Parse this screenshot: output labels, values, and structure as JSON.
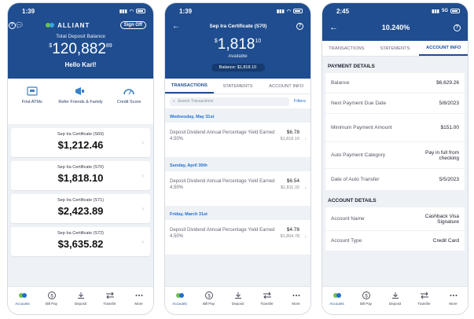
{
  "colors": {
    "brand_blue": "#1f4d8f",
    "accent_link": "#1f6fd1",
    "bg": "#eef1f5"
  },
  "phone1": {
    "time": "1:39",
    "brand": "ALLIANT",
    "sign_off": "Sign Off",
    "total_label": "Total Deposit Balance",
    "total_currency": "$",
    "total_main": "120,882",
    "total_cents": "89",
    "greeting": "Hello Karl!",
    "quick_actions": [
      {
        "label": "Find ATMs",
        "icon": "atm-icon"
      },
      {
        "label": "Refer Friends & Family",
        "icon": "megaphone-icon"
      },
      {
        "label": "Credit Score",
        "icon": "gauge-icon"
      }
    ],
    "accounts": [
      {
        "name": "Sep Ira Certificate (S69)",
        "amount": "$1,212.46"
      },
      {
        "name": "Sep Ira Certificate (S70)",
        "amount": "$1,818.10"
      },
      {
        "name": "Sep Ira Certificate (S71)",
        "amount": "$2,423.89"
      },
      {
        "name": "Sep Ira Certificate (S72)",
        "amount": "$3,635.82"
      }
    ]
  },
  "tabbar": [
    {
      "label": "Accounts",
      "icon": "accounts-icon"
    },
    {
      "label": "Bill Pay",
      "icon": "dollar-icon"
    },
    {
      "label": "Deposit",
      "icon": "deposit-icon"
    },
    {
      "label": "Transfer",
      "icon": "transfer-icon"
    },
    {
      "label": "More",
      "icon": "more-icon"
    }
  ],
  "phone2": {
    "time": "1:39",
    "title": "Sep Ira Certificate (S70)",
    "amount_currency": "$",
    "amount_main": "1,818",
    "amount_cents": "10",
    "available": "Available",
    "balance_pill": "Balance: $1,818.10",
    "tabs": [
      "TRANSACTIONS",
      "STATEMENTS",
      "ACCOUNT INFO"
    ],
    "search_placeholder": "Search Transactions",
    "filters": "Filters",
    "groups": [
      {
        "date": "Wednesday, May 31st",
        "desc": "Deposit Dividend Annual Percentage Yield Earned 4.50%",
        "amount": "$6.78",
        "balance": "$1,818.10"
      },
      {
        "date": "Sunday, April 30th",
        "desc": "Deposit Dividend Annual Percentage Yield Earned 4.50%",
        "amount": "$6.54",
        "balance": "$1,811.32"
      },
      {
        "date": "Friday, March 31st",
        "desc": "Deposit Dividend Annual Percentage Yield Earned 4.50%",
        "amount": "$4.78",
        "balance": "$1,804.78"
      }
    ]
  },
  "phone3": {
    "time": "2:45",
    "signal": "5G",
    "title": "10.240%",
    "tabs": [
      "TRANSACTIONS",
      "STATEMENTS",
      "ACCOUNT INFO"
    ],
    "payment_section": "PAYMENT DETAILS",
    "payment_rows": [
      {
        "label": "Balance",
        "value": "$6,629.26"
      },
      {
        "label": "Next Payment Due Date",
        "value": "5/8/2023"
      },
      {
        "label": "Minimum Payment Amount",
        "value": "$151.00"
      },
      {
        "label": "Auto Payment Category",
        "value": "Pay in full from checking"
      },
      {
        "label": "Date of Auto Transfer",
        "value": "5/5/2023"
      }
    ],
    "account_section": "ACCOUNT DETAILS",
    "account_rows": [
      {
        "label": "Account Name",
        "value": "Cashback Visa Signature"
      },
      {
        "label": "Account Type",
        "value": "Credit Card"
      }
    ]
  }
}
